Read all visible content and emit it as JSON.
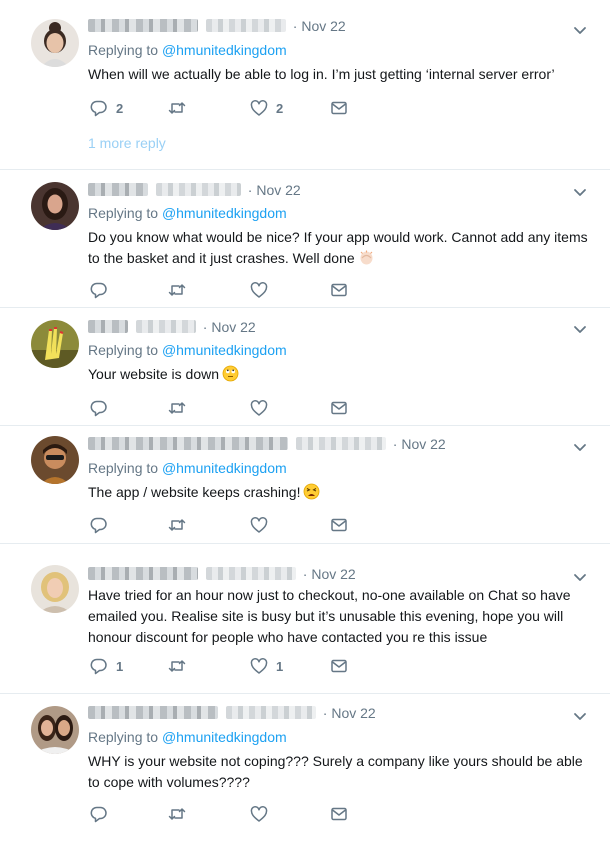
{
  "icons": {
    "reply": "reply-icon",
    "retweet": "retweet-icon",
    "like": "heart-icon",
    "message": "envelope-icon",
    "more": "chevron-down-icon"
  },
  "colors": {
    "accent": "#1da1f2",
    "muted": "#657786",
    "text": "#14171a",
    "divider": "#e6ecf0"
  },
  "tweets": [
    {
      "date": "· Nov 22",
      "replying_prefix": "Replying to",
      "replying_handle": "@hmunitedkingdom",
      "text": "When will we actually be able to log in. I’m just getting ‘internal server error’",
      "reply_count": "2",
      "like_count": "2",
      "more_replies": "1 more reply"
    },
    {
      "date": "· Nov 22",
      "replying_prefix": "Replying to",
      "replying_handle": "@hmunitedkingdom",
      "text": "Do you know what would be nice? If your app would work. Cannot add any items to the basket and it just crashes. Well done",
      "emoji": "clapping-hands-emoji"
    },
    {
      "date": "· Nov 22",
      "replying_prefix": "Replying to",
      "replying_handle": "@hmunitedkingdom",
      "text": "Your website is down",
      "emoji": "rolling-eyes-emoji"
    },
    {
      "date": "· Nov 22",
      "replying_prefix": "Replying to",
      "replying_handle": "@hmunitedkingdom",
      "text": "The app / website keeps crashing!",
      "emoji": "tired-face-emoji"
    },
    {
      "date": "· Nov 22",
      "text": "Have tried for an hour now just to checkout, no-one available on Chat so have emailed you. Realise site is busy but it’s unusable this evening, hope you will honour discount for people who have contacted you re this issue",
      "reply_count": "1",
      "like_count": "1"
    },
    {
      "date": "· Nov 22",
      "replying_prefix": "Replying to",
      "replying_handle": "@hmunitedkingdom",
      "text": "WHY is your website not coping??? Surely a company like yours should be able to cope with volumes????"
    }
  ]
}
